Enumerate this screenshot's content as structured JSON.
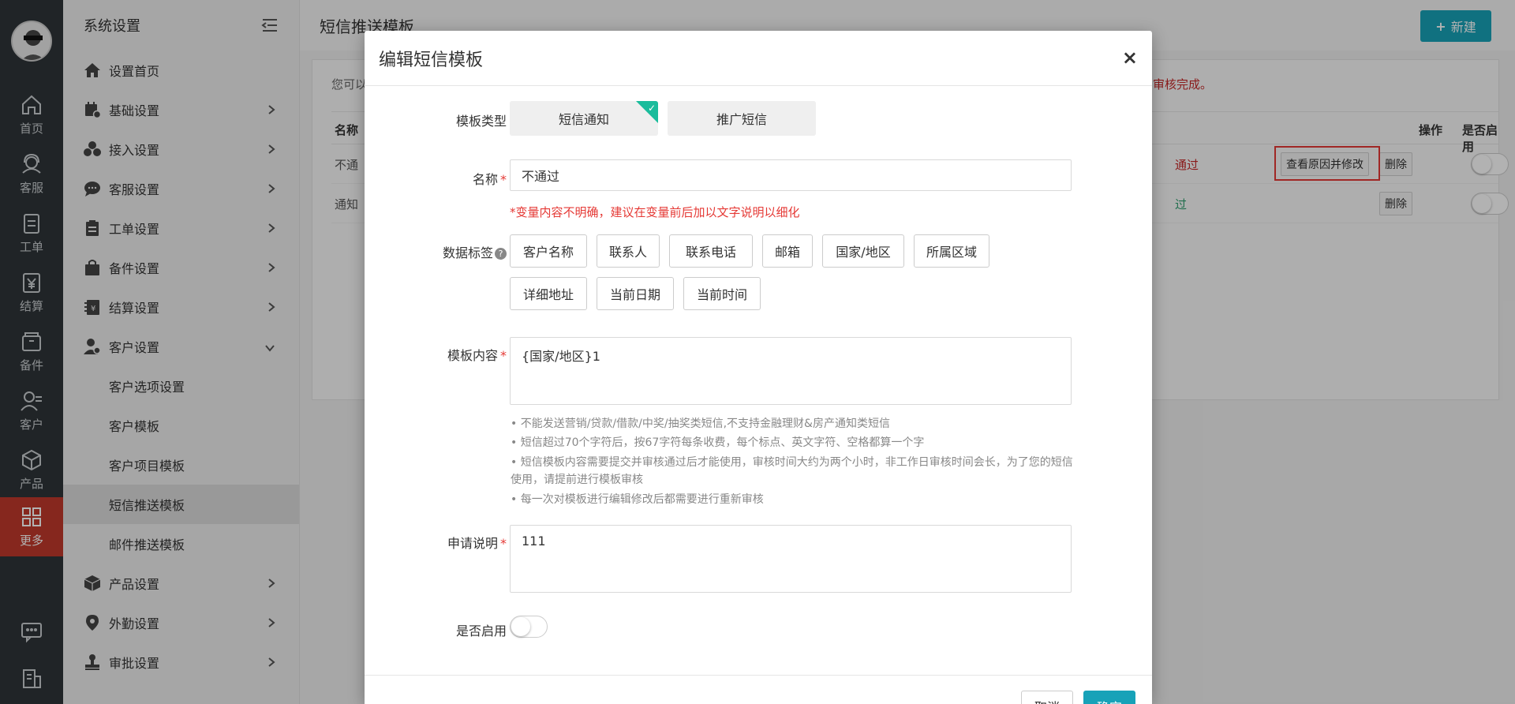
{
  "rail": {
    "items": [
      {
        "label": "首页",
        "icon": "home-icon"
      },
      {
        "label": "客服",
        "icon": "headset-icon"
      },
      {
        "label": "工单",
        "icon": "ticket-icon"
      },
      {
        "label": "结算",
        "icon": "yen-icon"
      },
      {
        "label": "备件",
        "icon": "box-icon"
      },
      {
        "label": "客户",
        "icon": "customer-icon"
      },
      {
        "label": "产品",
        "icon": "product-icon"
      },
      {
        "label": "更多",
        "icon": "grid-icon"
      }
    ]
  },
  "sidebar": {
    "title": "系统设置",
    "items": [
      {
        "label": "设置首页",
        "icon": "home-icon"
      },
      {
        "label": "基础设置",
        "icon": "calendar-gear-icon"
      },
      {
        "label": "接入设置",
        "icon": "users-icon"
      },
      {
        "label": "客服设置",
        "icon": "chat-icon"
      },
      {
        "label": "工单设置",
        "icon": "clipboard-icon"
      },
      {
        "label": "备件设置",
        "icon": "bag-icon"
      },
      {
        "label": "结算设置",
        "icon": "ledger-icon"
      },
      {
        "label": "客户设置",
        "icon": "user-gear-icon"
      }
    ],
    "sub_items": [
      "客户选项设置",
      "客户模板",
      "客户项目模板",
      "短信推送模板",
      "邮件推送模板"
    ],
    "items_after": [
      {
        "label": "产品设置",
        "icon": "cube-icon"
      },
      {
        "label": "外勤设置",
        "icon": "location-icon"
      },
      {
        "label": "审批设置",
        "icon": "stamp-icon"
      }
    ]
  },
  "main": {
    "title": "短信推送模板",
    "new_button": "新建",
    "note_start": "您可以",
    "note_end": "审核完成。",
    "columns": {
      "name": "名称",
      "action": "操作",
      "enabled": "是否启用"
    },
    "rows": [
      {
        "name": "不通",
        "status": "通过",
        "view_button": "查看原因并修改",
        "delete_button": "删除"
      },
      {
        "name": "通知",
        "status": "过",
        "delete_button": "删除"
      }
    ]
  },
  "modal": {
    "title": "编辑短信模板",
    "close": "×",
    "type_label": "模板类型",
    "types": [
      "短信通知",
      "推广短信"
    ],
    "name_label": "名称",
    "name_value": "不通过",
    "warning": "*变量内容不明确，建议在变量前后加以文字说明以细化",
    "tags_label": "数据标签",
    "tags": [
      "客户名称",
      "联系人",
      "联系电话",
      "邮箱",
      "国家/地区",
      "所属区域",
      "详细地址",
      "当前日期",
      "当前时间"
    ],
    "content_label": "模板内容",
    "content_value": "{国家/地区}1",
    "tips": [
      "• 不能发送营销/贷款/借款/中奖/抽奖类短信,不支持金融理财&房产通知类短信",
      "• 短信超过70个字符后，按67字符每条收费，每个标点、英文字符、空格都算一个字",
      "• 短信模板内容需要提交并审核通过后才能使用，审核时间大约为两个小时，非工作日审核时间会长，为了您的短信使用，请提前进行模板审核",
      "• 每一次对模板进行编辑修改后都需要进行重新审核"
    ],
    "desc_label": "申请说明",
    "desc_value": "111",
    "enabled_label": "是否启用",
    "cancel_button": "取消",
    "ok_button": "确定"
  },
  "colors": {
    "accent": "#17a2b8",
    "danger": "#e53935",
    "rail_active": "#c0392b",
    "check": "#1abc9c"
  }
}
